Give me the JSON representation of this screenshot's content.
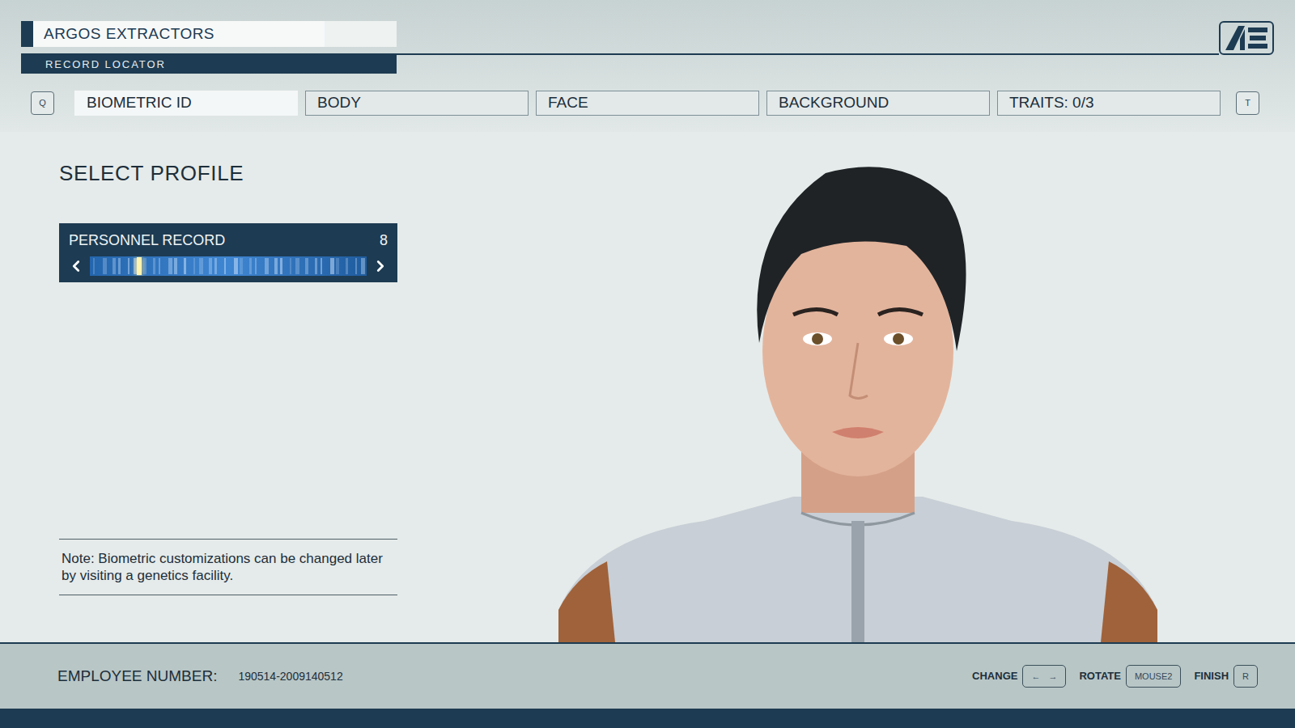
{
  "header": {
    "title": "ARGOS EXTRACTORS",
    "subtitle": "RECORD LOCATOR"
  },
  "tab_nav": {
    "prev_key": "Q",
    "next_key": "T"
  },
  "tabs": [
    {
      "label": "BIOMETRIC ID",
      "selected": true
    },
    {
      "label": "BODY",
      "selected": false
    },
    {
      "label": "FACE",
      "selected": false
    },
    {
      "label": "BACKGROUND",
      "selected": false
    },
    {
      "label": "TRAITS: 0/3",
      "selected": false
    }
  ],
  "panel": {
    "heading": "SELECT PROFILE",
    "selector": {
      "label": "PERSONNEL RECORD",
      "value": "8",
      "level": 0.17
    },
    "note": "Note: Biometric customizations can be changed later by visiting a genetics facility."
  },
  "footer": {
    "employee_label": "EMPLOYEE NUMBER:",
    "employee_number": "190514-2009140512",
    "controls": [
      {
        "label": "CHANGE",
        "keys": [
          "←",
          "→"
        ]
      },
      {
        "label": "ROTATE",
        "keys": [
          "MOUSE2"
        ]
      },
      {
        "label": "FINISH",
        "keys": [
          "R"
        ]
      }
    ]
  }
}
